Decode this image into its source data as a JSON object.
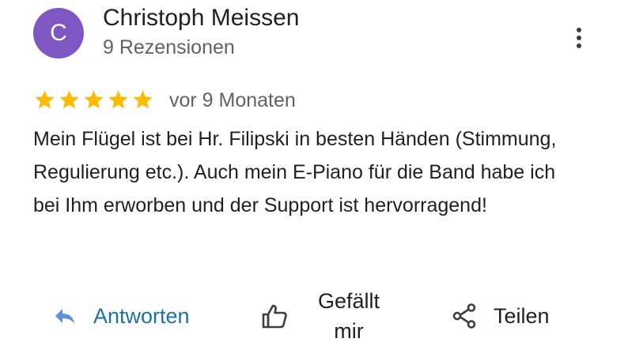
{
  "review": {
    "author": {
      "initial": "C",
      "name": "Christoph Meissen",
      "reviews_count": "9 Rezensionen",
      "avatar_color": "#7e57c2"
    },
    "rating": 5,
    "rating_max": 5,
    "star_color": "#fbbc04",
    "time": "vor 9 Monaten",
    "text": "Mein Flügel ist bei Hr. Filipski in besten Händen (Stimmung, Regulierung etc.). Auch mein E-Piano für die Band habe ich bei Ihm erworben und der Support ist hervorragend!"
  },
  "actions": {
    "reply": {
      "label": "Antworten",
      "icon": "reply-icon",
      "color": "#1a73a8"
    },
    "like": {
      "label_line1": "Gefällt",
      "label_line2": "mir",
      "icon": "thumbs-up-icon"
    },
    "share": {
      "label": "Teilen",
      "icon": "share-icon"
    }
  },
  "menu": {
    "icon": "more-vert-icon"
  }
}
